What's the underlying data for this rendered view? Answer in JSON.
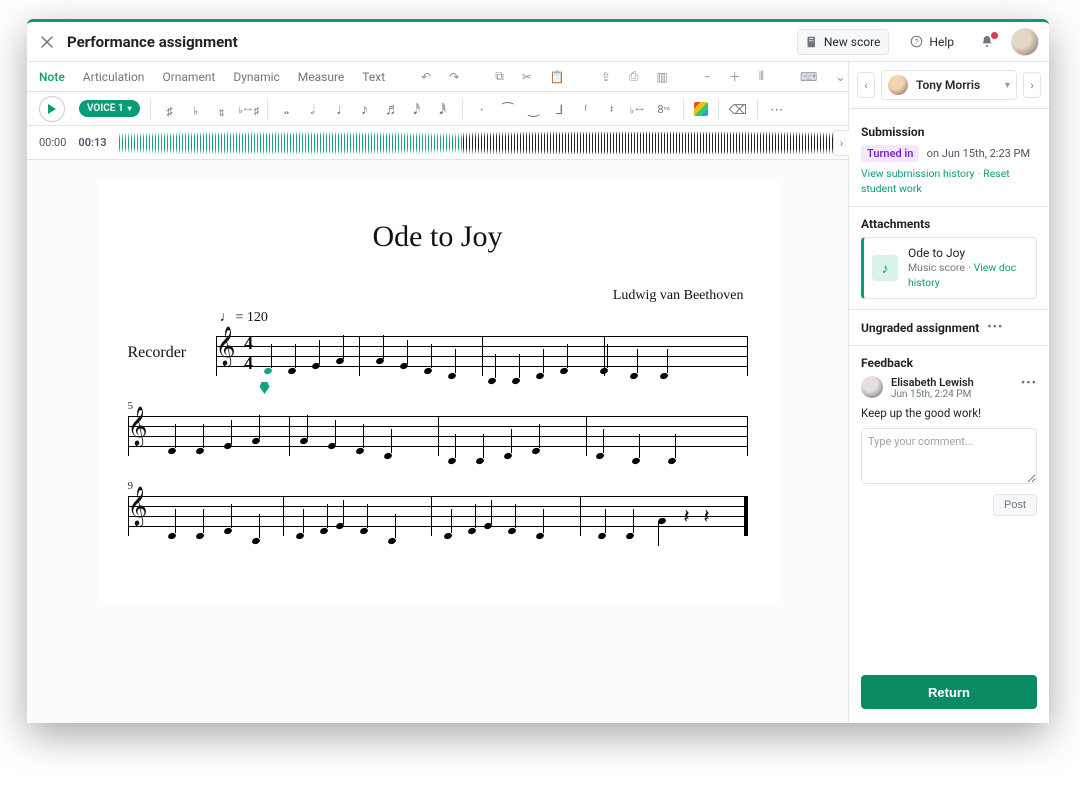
{
  "header": {
    "title": "Performance assignment",
    "new_score": "New score",
    "help": "Help"
  },
  "toolbar": {
    "tabs": {
      "note": "Note",
      "articulation": "Articulation",
      "ornament": "Ornament",
      "dynamic": "Dynamic",
      "measure": "Measure",
      "text": "Text"
    },
    "voice_chip": "VOICE 1"
  },
  "timeline": {
    "start": "00:00",
    "current": "00:13"
  },
  "score": {
    "title": "Ode to Joy",
    "composer": "Ludwig van Beethoven",
    "tempo": "= 120",
    "instrument": "Recorder",
    "bar_system2": "5",
    "bar_system3": "9"
  },
  "student": {
    "name": "Tony Morris"
  },
  "submission": {
    "heading": "Submission",
    "status": "Turned in",
    "when": "on Jun 15th, 2:23 PM",
    "view_history": "View submission history",
    "reset": "Reset student work"
  },
  "attachments": {
    "heading": "Attachments",
    "item": {
      "title": "Ode to Joy",
      "subtitle_type": "Music score",
      "view_doc": "View doc history"
    }
  },
  "grading": {
    "heading": "Ungraded assignment"
  },
  "feedback": {
    "heading": "Feedback",
    "author": "Elisabeth Lewish",
    "time": "Jun 15th, 2:24 PM",
    "body": "Keep up the good work!",
    "placeholder": "Type your comment...",
    "post": "Post"
  },
  "return_label": "Return"
}
